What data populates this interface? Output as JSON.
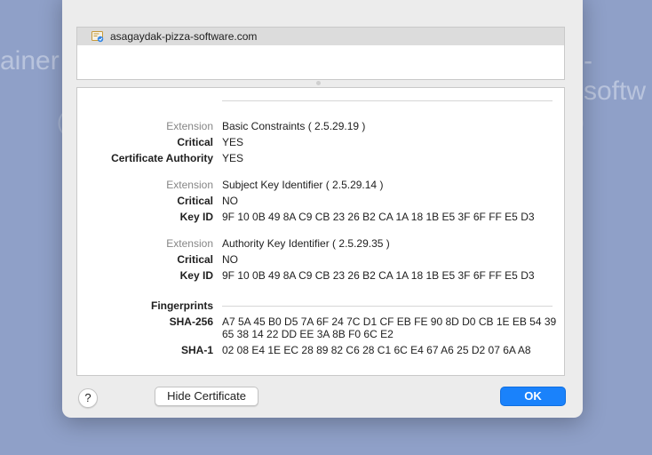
{
  "background": {
    "left_text": "ainer",
    "right_text": "-softw"
  },
  "cert_list": {
    "selected_name": "asagaydak-pizza-software.com"
  },
  "details": {
    "extensions": [
      {
        "rows": [
          {
            "label": "Extension",
            "value": "Basic Constraints ( 2.5.29.19 )"
          },
          {
            "label": "Critical",
            "value": "YES"
          },
          {
            "label": "Certificate Authority",
            "value": "YES"
          }
        ]
      },
      {
        "rows": [
          {
            "label": "Extension",
            "value": "Subject Key Identifier ( 2.5.29.14 )"
          },
          {
            "label": "Critical",
            "value": "NO"
          },
          {
            "label": "Key ID",
            "value": "9F 10 0B 49 8A C9 CB 23 26 B2 CA 1A 18 1B E5 3F 6F FF E5 D3"
          }
        ]
      },
      {
        "rows": [
          {
            "label": "Extension",
            "value": "Authority Key Identifier ( 2.5.29.35 )"
          },
          {
            "label": "Critical",
            "value": "NO"
          },
          {
            "label": "Key ID",
            "value": "9F 10 0B 49 8A C9 CB 23 26 B2 CA 1A 18 1B E5 3F 6F FF E5 D3"
          }
        ]
      }
    ],
    "fingerprints": {
      "header": "Fingerprints",
      "sha256_label": "SHA-256",
      "sha256_value": "A7 5A 45 B0 D5 7A 6F 24 7C D1 CF EB FE 90 8D D0 CB 1E EB 54 39 65 38 14 22 DD EE 3A 8B F0 6C E2",
      "sha1_label": "SHA-1",
      "sha1_value": "02 08 E4 1E EC 28 89 82 C6 28 C1 6C E4 67 A6 25 D2 07 6A A8"
    }
  },
  "buttons": {
    "help": "?",
    "hide_certificate": "Hide Certificate",
    "ok": "OK"
  },
  "icons": {
    "certificate": "certificate-icon",
    "help": "question-mark"
  },
  "colors": {
    "background": "#8fa0c8",
    "accent": "#1a82fb",
    "selection": "#dcdcdc"
  }
}
